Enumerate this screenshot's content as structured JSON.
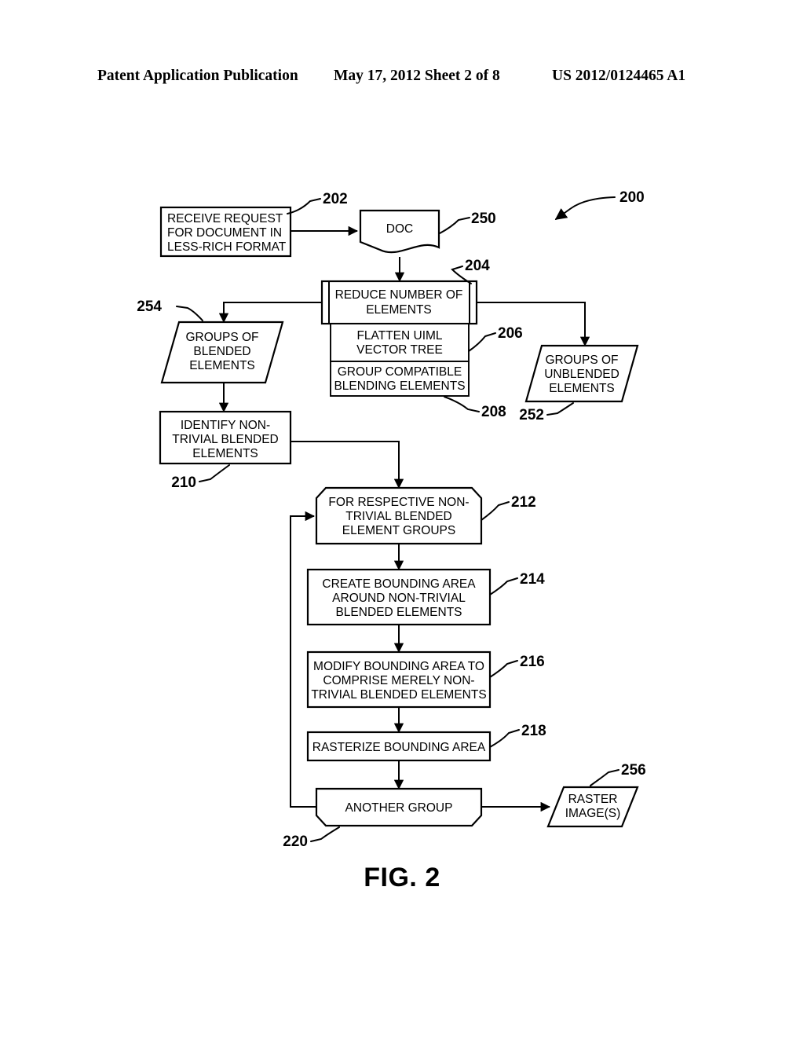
{
  "header": {
    "left": "Patent Application Publication",
    "middle": "May 17, 2012  Sheet 2 of 8",
    "right": "US 2012/0124465 A1"
  },
  "figure": {
    "caption": "FIG. 2",
    "overall_ref": "200"
  },
  "nodes": {
    "receive_request": {
      "ref": "202",
      "lines": [
        "RECEIVE REQUEST",
        "FOR DOCUMENT IN",
        "LESS-RICH FORMAT"
      ]
    },
    "doc": {
      "ref": "250",
      "lines": [
        "DOC"
      ]
    },
    "reduce_elements": {
      "ref": "204",
      "lines": [
        "REDUCE NUMBER OF",
        "ELEMENTS"
      ]
    },
    "flatten_tree": {
      "ref": "206",
      "lines": [
        "FLATTEN UIML",
        "VECTOR TREE"
      ]
    },
    "group_compatible": {
      "ref": "208",
      "lines": [
        "GROUP COMPATIBLE",
        "BLENDING ELEMENTS"
      ]
    },
    "groups_blended": {
      "ref": "254",
      "lines": [
        "GROUPS OF",
        "BLENDED",
        "ELEMENTS"
      ]
    },
    "groups_unblended": {
      "ref": "252",
      "lines": [
        "GROUPS OF",
        "UNBLENDED",
        "ELEMENTS"
      ]
    },
    "identify_nontrivial": {
      "ref": "210",
      "lines": [
        "IDENTIFY NON-",
        "TRIVIAL BLENDED",
        "ELEMENTS"
      ]
    },
    "for_respective": {
      "ref": "212",
      "lines": [
        "FOR RESPECTIVE NON-",
        "TRIVIAL BLENDED",
        "ELEMENT GROUPS"
      ]
    },
    "create_bounding": {
      "ref": "214",
      "lines": [
        "CREATE BOUNDING AREA",
        "AROUND NON-TRIVIAL",
        "BLENDED ELEMENTS"
      ]
    },
    "modify_bounding": {
      "ref": "216",
      "lines": [
        "MODIFY BOUNDING AREA TO",
        "COMPRISE MERELY NON-",
        "TRIVIAL BLENDED ELEMENTS"
      ]
    },
    "rasterize_bounding": {
      "ref": "218",
      "lines": [
        "RASTERIZE BOUNDING AREA"
      ]
    },
    "another_group": {
      "ref": "220",
      "lines": [
        "ANOTHER GROUP"
      ]
    },
    "raster_images": {
      "ref": "256",
      "lines": [
        "RASTER",
        "IMAGE(S)"
      ]
    }
  },
  "colors": {
    "stroke": "#000000",
    "fill": "#ffffff"
  }
}
